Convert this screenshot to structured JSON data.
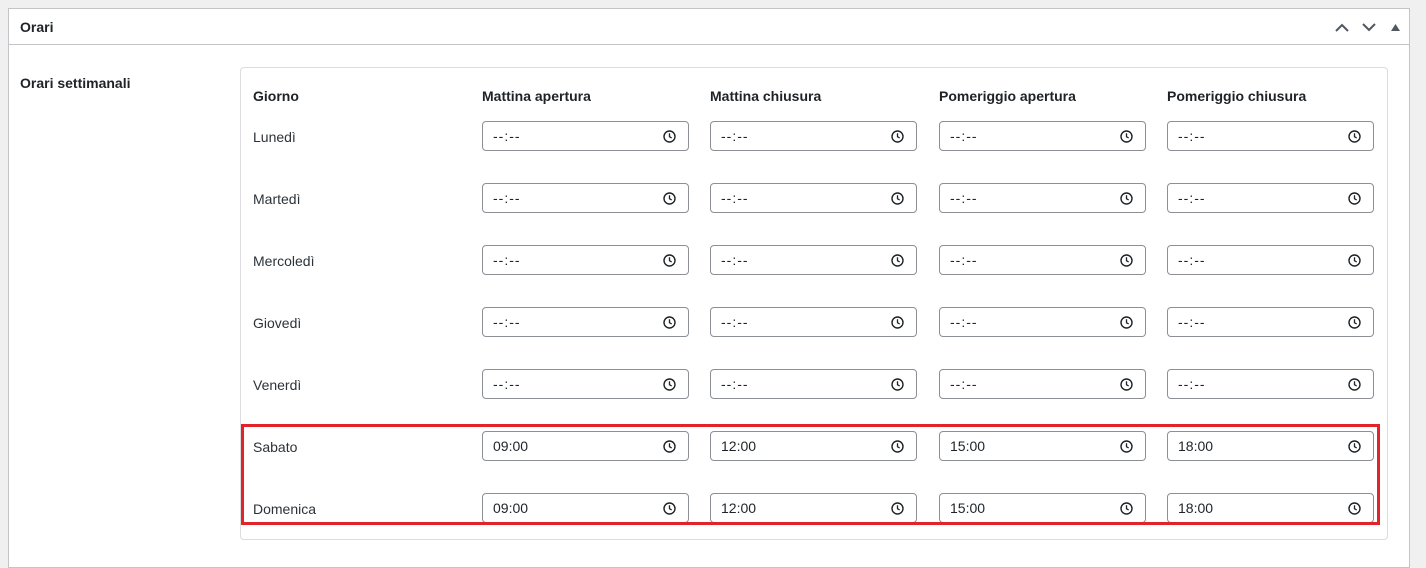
{
  "metabox": {
    "title": "Orari",
    "controls": [
      "move-up-icon",
      "move-down-icon",
      "toggle-icon"
    ]
  },
  "field": {
    "label": "Orari settimanali"
  },
  "table": {
    "headers": [
      "Giorno",
      "Mattina apertura",
      "Mattina chiusura",
      "Pomeriggio apertura",
      "Pomeriggio chiusura"
    ],
    "rows": [
      {
        "day": "Lunedì",
        "times": [
          "--:--",
          "--:--",
          "--:--",
          "--:--"
        ]
      },
      {
        "day": "Martedì",
        "times": [
          "--:--",
          "--:--",
          "--:--",
          "--:--"
        ]
      },
      {
        "day": "Mercoledì",
        "times": [
          "--:--",
          "--:--",
          "--:--",
          "--:--"
        ]
      },
      {
        "day": "Giovedì",
        "times": [
          "--:--",
          "--:--",
          "--:--",
          "--:--"
        ]
      },
      {
        "day": "Venerdì",
        "times": [
          "--:--",
          "--:--",
          "--:--",
          "--:--"
        ]
      },
      {
        "day": "Sabato",
        "times": [
          "09:00",
          "12:00",
          "15:00",
          "18:00"
        ]
      },
      {
        "day": "Domenica",
        "times": [
          "09:00",
          "12:00",
          "15:00",
          "18:00"
        ]
      }
    ]
  },
  "highlight_color": "#e3232a",
  "icons": {
    "time": "clock-icon"
  }
}
